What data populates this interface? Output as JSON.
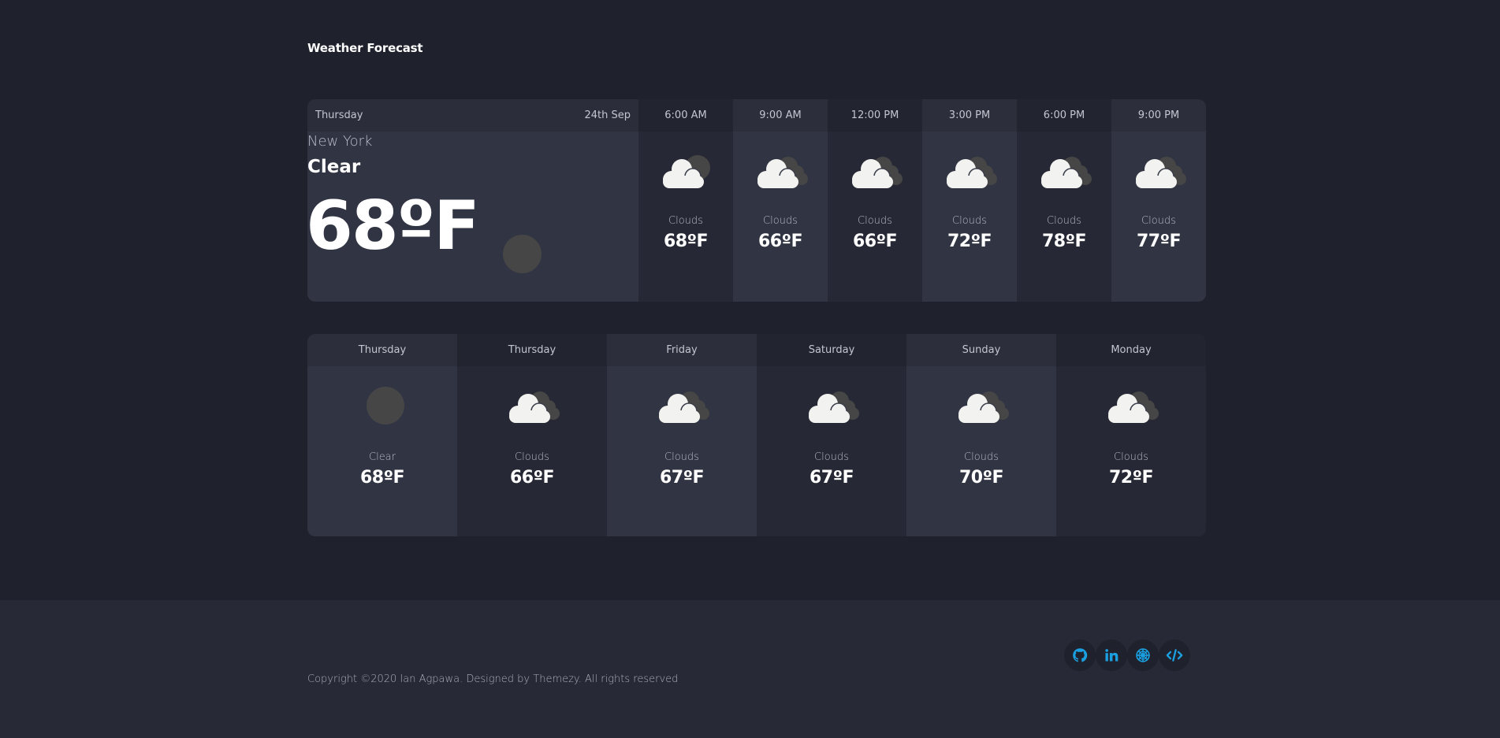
{
  "header": {
    "title": "Weather Forecast"
  },
  "today": {
    "day": "Thursday",
    "date": "24th Sep",
    "city": "New York",
    "condition": "Clear",
    "temperature": "68ºF",
    "icon": "clear-sun-icon"
  },
  "hourly": [
    {
      "time": "6:00 AM",
      "condition": "Clouds",
      "temperature": "68ºF",
      "icon": "few-clouds-icon"
    },
    {
      "time": "9:00 AM",
      "condition": "Clouds",
      "temperature": "66ºF",
      "icon": "broken-clouds-icon"
    },
    {
      "time": "12:00 PM",
      "condition": "Clouds",
      "temperature": "66ºF",
      "icon": "broken-clouds-icon"
    },
    {
      "time": "3:00 PM",
      "condition": "Clouds",
      "temperature": "72ºF",
      "icon": "broken-clouds-icon"
    },
    {
      "time": "6:00 PM",
      "condition": "Clouds",
      "temperature": "78ºF",
      "icon": "broken-clouds-icon"
    },
    {
      "time": "9:00 PM",
      "condition": "Clouds",
      "temperature": "77ºF",
      "icon": "broken-clouds-icon"
    }
  ],
  "daily": [
    {
      "day": "Thursday",
      "condition": "Clear",
      "temperature": "68ºF",
      "icon": "clear-sun-icon"
    },
    {
      "day": "Thursday",
      "condition": "Clouds",
      "temperature": "66ºF",
      "icon": "broken-clouds-icon"
    },
    {
      "day": "Friday",
      "condition": "Clouds",
      "temperature": "67ºF",
      "icon": "broken-clouds-icon"
    },
    {
      "day": "Saturday",
      "condition": "Clouds",
      "temperature": "67ºF",
      "icon": "broken-clouds-icon"
    },
    {
      "day": "Sunday",
      "condition": "Clouds",
      "temperature": "70ºF",
      "icon": "broken-clouds-icon"
    },
    {
      "day": "Monday",
      "condition": "Clouds",
      "temperature": "72ºF",
      "icon": "broken-clouds-icon"
    }
  ],
  "footer": {
    "copyright": "Copyright ©2020 Ian Agpawa. Designed by Themezy. All rights reserved",
    "socials": [
      {
        "name": "github",
        "icon": "github-icon"
      },
      {
        "name": "linkedin",
        "icon": "linkedin-icon"
      },
      {
        "name": "empire",
        "icon": "galactic-empire-icon"
      },
      {
        "name": "code",
        "icon": "code-icon"
      }
    ],
    "accent": "#1a9fe0"
  },
  "colors": {
    "background": "#1f212c",
    "panel_light": "#313442",
    "panel_dark": "#262935",
    "footer_bg": "#272a36"
  }
}
